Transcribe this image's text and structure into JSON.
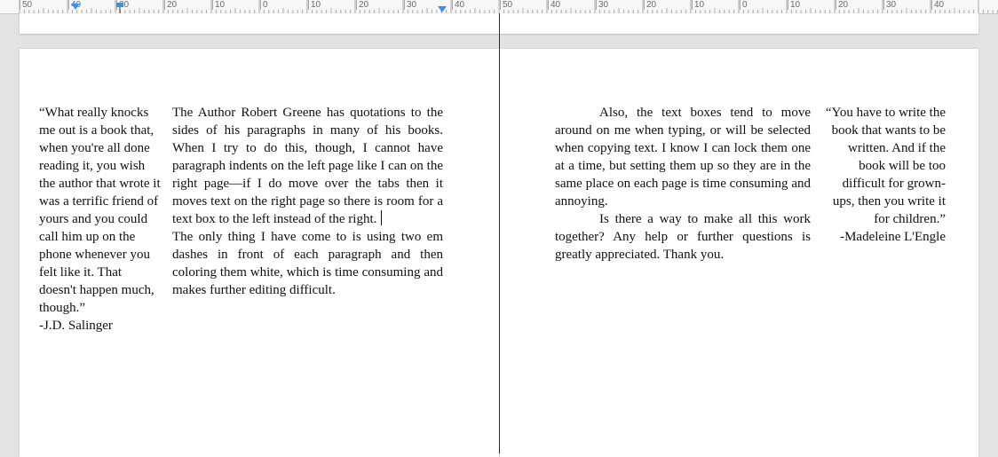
{
  "ruler": {
    "labels": [
      "50",
      "40",
      "30",
      "20",
      "10",
      "0",
      "10",
      "20",
      "30",
      "40",
      "50",
      "40",
      "30",
      "20",
      "10",
      "0",
      "10",
      "20",
      "30",
      "40"
    ],
    "marker_color": "#3d8fe8"
  },
  "left_page": {
    "sidebar_quote": "“What really knocks me out is a book that, when you're all done reading it, you wish the author that wrote it was a terrific friend of yours and you could call him up on the phone whenever you felt like it. That doesn't happen much, though.”",
    "sidebar_attribution": "-J.D. Salinger",
    "paragraph_1": "The Author Robert Greene has quotations to the sides of his paragraphs in many of his books. When I try to do this, though, I cannot have paragraph indents on the left page like I can on the right page—if I do move over the tabs then it moves text on the right page so there is room for a text box to the left instead of the right.",
    "paragraph_2": "The only thing I have come to is using two em dashes in front of each paragraph and then coloring them white, which is time consuming and makes further editing difficult."
  },
  "right_page": {
    "paragraph_1": "Also, the text boxes tend to move around on me when typing, or will be selected when copying text. I know I can lock them one at a time, but setting them up so they are in the same place on each page is time consuming and annoying.",
    "paragraph_2": "Is there a way to make all this work together? Any help or further questions is greatly appreciated. Thank you.",
    "sidebar_quote": "“You have to write the book that wants to be written. And if the book will be too difficult for grown-ups, then you write it for children.”",
    "sidebar_attribution": "-Madeleine L'Engle"
  }
}
